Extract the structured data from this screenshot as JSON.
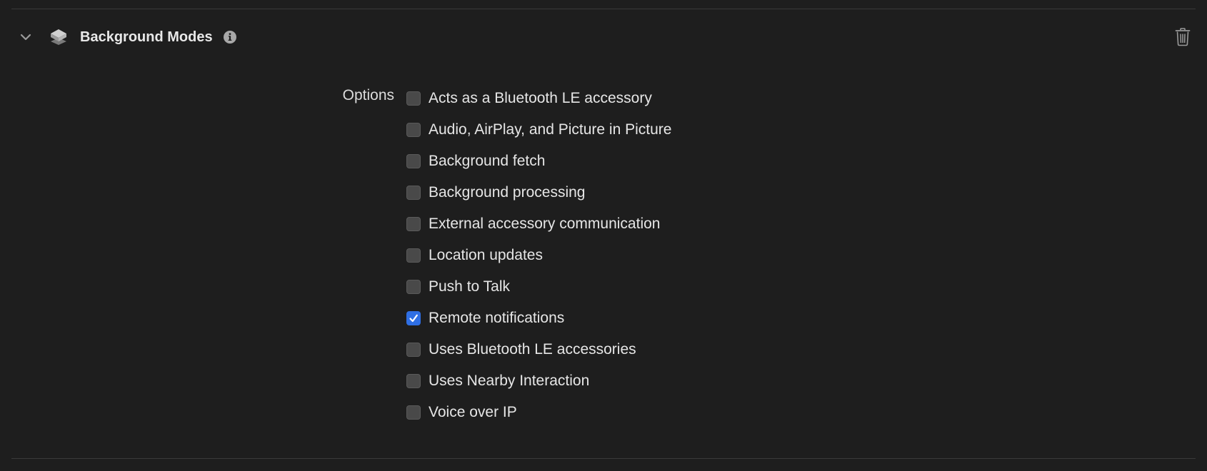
{
  "capability": {
    "title": "Background Modes",
    "chevron_icon": "chevron-down-icon",
    "capability_icon": "layers-icon",
    "info_icon": "info-icon",
    "delete_icon": "trash-icon"
  },
  "options": {
    "label": "Options",
    "items": [
      {
        "label": "Acts as a Bluetooth LE accessory",
        "checked": false
      },
      {
        "label": "Audio, AirPlay, and Picture in Picture",
        "checked": false
      },
      {
        "label": "Background fetch",
        "checked": false
      },
      {
        "label": "Background processing",
        "checked": false
      },
      {
        "label": "External accessory communication",
        "checked": false
      },
      {
        "label": "Location updates",
        "checked": false
      },
      {
        "label": "Push to Talk",
        "checked": false
      },
      {
        "label": "Remote notifications",
        "checked": true
      },
      {
        "label": "Uses Bluetooth LE accessories",
        "checked": false
      },
      {
        "label": "Uses Nearby Interaction",
        "checked": false
      },
      {
        "label": "Voice over IP",
        "checked": false
      }
    ]
  },
  "colors": {
    "background": "#1e1e1e",
    "checkbox_checked": "#2f6fe4",
    "checkbox_unchecked": "#494949"
  }
}
